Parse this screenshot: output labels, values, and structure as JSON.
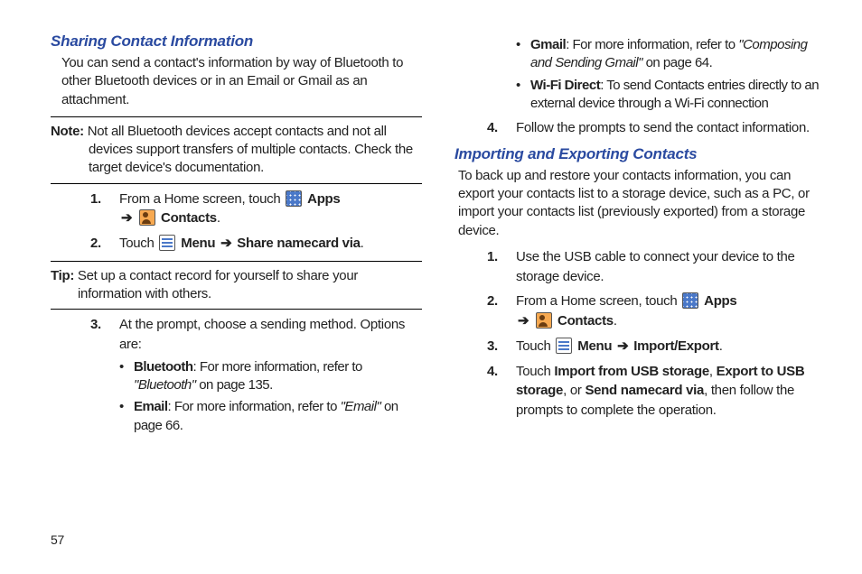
{
  "page_number": "57",
  "left": {
    "section1": {
      "title": "Sharing Contact Information",
      "intro": "You can send a contact's information by way of Bluetooth to other Bluetooth devices or in an Email or Gmail as an attachment.",
      "note_label": "Note:",
      "note_body": "Not all Bluetooth devices accept contacts and not all devices support transfers of multiple contacts. Check the target device's documentation.",
      "step1_num": "1.",
      "step1_a": "From a Home screen, touch ",
      "step1_apps": " Apps",
      "step1_arrow": "➔",
      "step1_contacts": " Contacts",
      "step1_end": ".",
      "step2_num": "2.",
      "step2_a": "Touch ",
      "step2_menu": " Menu ",
      "step2_arrow": "➔",
      "step2_share": " Share namecard via",
      "step2_end": ".",
      "tip_label": "Tip:",
      "tip_body": "Set up a contact record for yourself to share your information with others.",
      "step3_num": "3.",
      "step3_text": "At the prompt, choose a sending method. Options are:",
      "b1_label": "Bluetooth",
      "b1_mid": ": For more information, refer to ",
      "b1_ref": "\"Bluetooth\"",
      "b1_end": "  on page 135.",
      "b2_label": "Email",
      "b2_mid": ": For more information, refer to ",
      "b2_ref": "\"Email\"",
      "b2_end": "  on page 66."
    }
  },
  "right": {
    "b3_label": "Gmail",
    "b3_mid": ": For more information, refer to ",
    "b3_ref": "\"Composing and Sending Gmail\"",
    "b3_end": "  on page 64.",
    "b4_label": "Wi-Fi Direct",
    "b4_body": ": To send Contacts entries directly to an external device through a Wi-Fi connection",
    "step4_num": "4.",
    "step4_text": "Follow the prompts to send the contact information.",
    "section2": {
      "title": "Importing and Exporting Contacts",
      "intro": "To back up and restore your contacts information, you can export your contacts list to a storage device, such as a PC, or import your contacts list (previously exported) from a storage device.",
      "s1_num": "1.",
      "s1_text": "Use the USB cable to connect your device to the storage device.",
      "s2_num": "2.",
      "s2_a": "From a Home screen, touch ",
      "s2_apps": " Apps",
      "s2_arrow": "➔",
      "s2_contacts": " Contacts",
      "s2_end": ".",
      "s3_num": "3.",
      "s3_a": "Touch ",
      "s3_menu": " Menu ",
      "s3_arrow": "➔",
      "s3_imp": " Import/Export",
      "s3_end": ".",
      "s4_num": "4.",
      "s4_a": "Touch ",
      "s4_o1": "Import from USB storage",
      "s4_c1": ", ",
      "s4_o2": "Export to USB storage",
      "s4_c2": ", or ",
      "s4_o3": "Send namecard via",
      "s4_end": ", then follow the prompts to complete the operation."
    }
  }
}
